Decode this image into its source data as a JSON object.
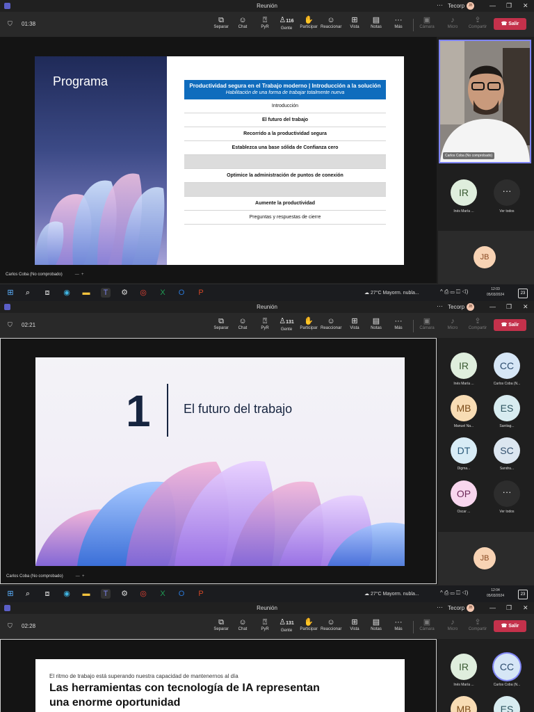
{
  "window": {
    "title": "Reunión",
    "org": "Tecorp",
    "org_avatar": "JB"
  },
  "toolbar": {
    "buttons": [
      {
        "label": "Separar",
        "icon": "pop-out-icon"
      },
      {
        "label": "Chat",
        "icon": "chat-icon"
      },
      {
        "label": "PyR",
        "icon": "qa-icon"
      },
      {
        "label": "Gente",
        "icon": "people-icon"
      },
      {
        "label": "Participar",
        "icon": "raise-hand-icon"
      },
      {
        "label": "Reaccionar",
        "icon": "react-icon"
      },
      {
        "label": "Vista",
        "icon": "view-icon"
      },
      {
        "label": "Notas",
        "icon": "notes-icon"
      },
      {
        "label": "Más",
        "icon": "more-icon"
      }
    ],
    "device_buttons": [
      {
        "label": "Cámara",
        "icon": "camera-icon"
      },
      {
        "label": "Micro",
        "icon": "mic-icon"
      },
      {
        "label": "Compartir",
        "icon": "share-icon"
      }
    ],
    "leave_label": "Salir"
  },
  "frames": [
    {
      "timer": "01:38",
      "people_count": "116",
      "clock_time": "12:03",
      "slide": {
        "title": "Programa",
        "agenda_header": "Productividad segura en el Trabajo moderno | Introducción a la solución",
        "agenda_subheader": "Habilitación de una forma de trabajar totalmente nueva",
        "agenda_items": [
          {
            "text": "Introducción",
            "bold": false,
            "shaded": false
          },
          {
            "text": "El futuro del trabajo",
            "bold": true,
            "shaded": false
          },
          {
            "text": "Recorrido a la productividad segura",
            "bold": true,
            "shaded": false
          },
          {
            "text": "Establezca una base sólida de Confianza cero",
            "bold": true,
            "shaded": false
          },
          {
            "text": "",
            "bold": false,
            "shaded": true
          },
          {
            "text": "Optimice la administración de puntos de conexión",
            "bold": true,
            "shaded": false
          },
          {
            "text": "",
            "bold": false,
            "shaded": true
          },
          {
            "text": "Aumente la productividad",
            "bold": true,
            "shaded": false
          },
          {
            "text": "Preguntas y respuestas de cierre",
            "bold": false,
            "shaded": false
          }
        ]
      },
      "video_label": "Carlos Coba (No comprobado)",
      "participants": [
        {
          "initials": "IR",
          "name": "Inés María ...",
          "bg": "#dfeedd",
          "fg": "#3a5a32"
        }
      ],
      "more_label": "Ver todos"
    },
    {
      "timer": "02:21",
      "people_count": "131",
      "clock_time": "12:04",
      "slide": {
        "number": "1",
        "section_title": "El futuro del trabajo"
      },
      "participants": [
        {
          "initials": "IR",
          "name": "Inés María ...",
          "bg": "#dfeedd",
          "fg": "#3a5a32"
        },
        {
          "initials": "CC",
          "name": "Carlos Coba (N...",
          "bg": "#d6e6f6",
          "fg": "#2d4d6e"
        },
        {
          "initials": "MB",
          "name": "Manuel Na...",
          "bg": "#f8dcb4",
          "fg": "#7a4a18"
        },
        {
          "initials": "ES",
          "name": "Santiag...",
          "bg": "#d8ecf0",
          "fg": "#2d5560"
        },
        {
          "initials": "DT",
          "name": "Digma...",
          "bg": "#d8ecf6",
          "fg": "#2a5a7a"
        },
        {
          "initials": "SC",
          "name": "Sandra...",
          "bg": "#dce6f0",
          "fg": "#33506e"
        },
        {
          "initials": "OP",
          "name": "Oscar ...",
          "bg": "#f8d6ee",
          "fg": "#6e2a5a"
        }
      ],
      "more_label": "Ver todos"
    },
    {
      "timer": "02:28",
      "people_count": "131",
      "slide": {
        "kicker": "El ritmo de trabajo está superando nuestra capacidad de mantenernos al día",
        "headline_line1": "Las herramientas con tecnología de IA representan",
        "headline_line2": "una enorme oportunidad"
      },
      "participants": [
        {
          "initials": "IR",
          "name": "Inés María ...",
          "bg": "#dfeedd",
          "fg": "#3a5a32"
        },
        {
          "initials": "CC",
          "name": "Carlos Coba (N...",
          "bg": "#d6e6f6",
          "fg": "#2d4d6e"
        },
        {
          "initials": "MB",
          "name": "",
          "bg": "#f8dcb4",
          "fg": "#7a4a18"
        },
        {
          "initials": "ES",
          "name": "",
          "bg": "#d8ecf0",
          "fg": "#2d5560"
        }
      ]
    }
  ],
  "presenter_label": "Carlos Coba (No comprobado)",
  "jb_initials": "JB",
  "taskbar": {
    "weather": "27°C  Mayorm. nubla...",
    "date": "05/03/2024",
    "notif_count": "23",
    "apps": [
      "windows-icon",
      "search-icon",
      "task-view-icon",
      "edge-icon",
      "file-explorer-icon",
      "teams-icon",
      "settings-icon",
      "chrome-icon",
      "excel-icon",
      "outlook-icon",
      "powerpoint-icon"
    ]
  }
}
